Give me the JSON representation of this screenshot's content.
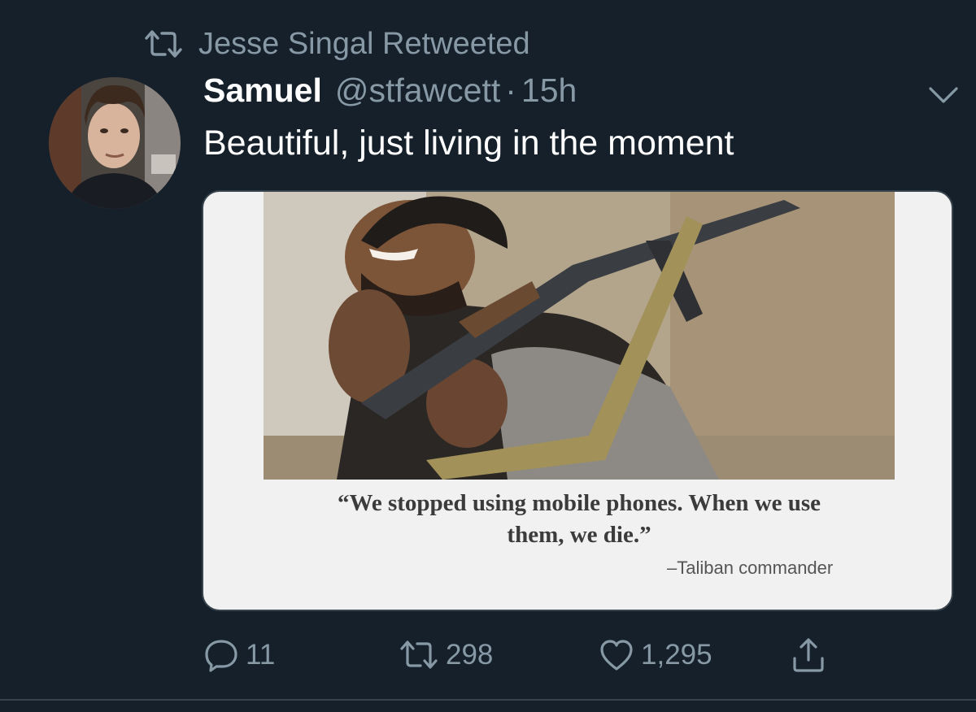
{
  "retweet_context": {
    "icon": "retweet-icon",
    "text": "Jesse Singal Retweeted"
  },
  "author": {
    "display_name": "Samuel",
    "handle": "@stfawcett",
    "separator": "·",
    "time": "15h"
  },
  "tweet": {
    "text": "Beautiful, just living in the moment"
  },
  "media": {
    "quote_lines": [
      "“We stopped using mobile phones. When we use",
      "them, we die.”"
    ],
    "attribution": "–Taliban commander"
  },
  "actions": {
    "reply_count": "11",
    "retweet_count": "298",
    "like_count": "1,295"
  },
  "colors": {
    "background": "#15202b",
    "secondary_text": "#8899a6",
    "divider": "#38444d"
  }
}
